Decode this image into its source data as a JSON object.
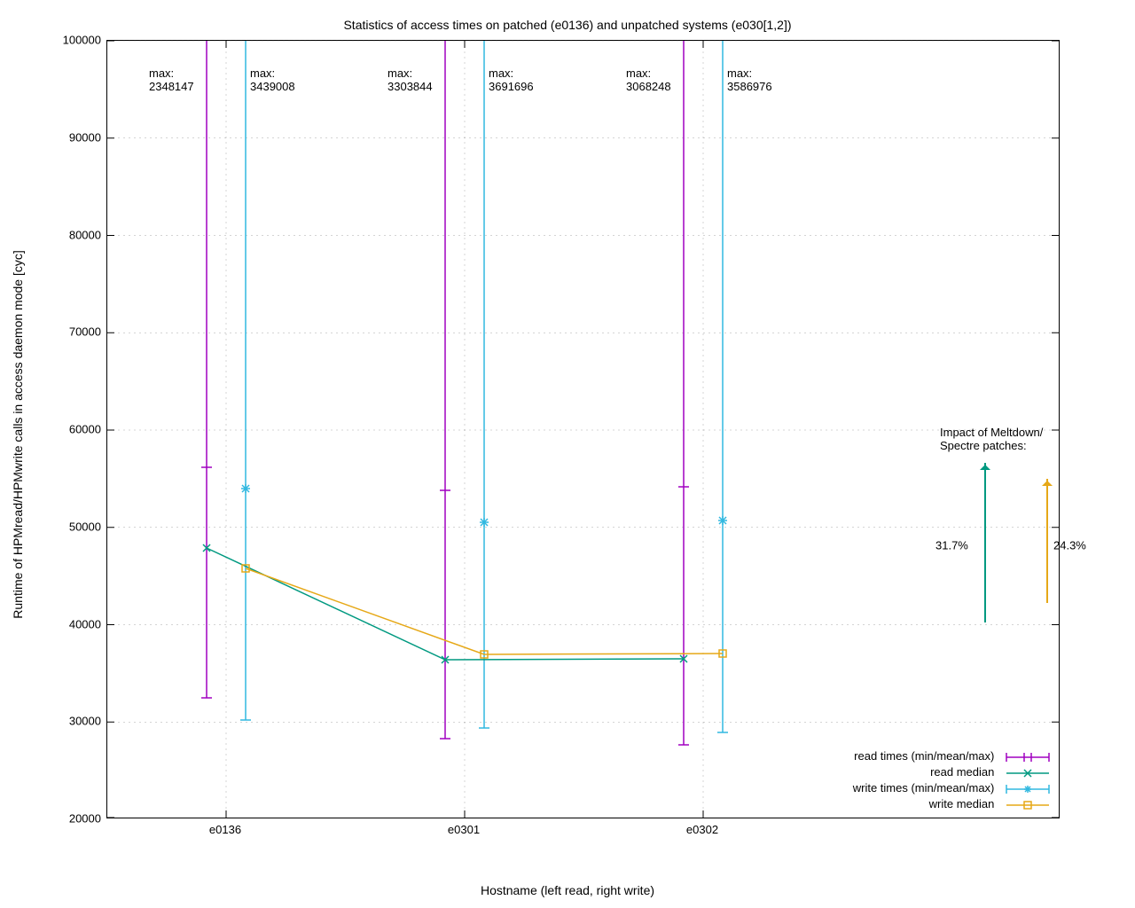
{
  "chart_data": {
    "type": "line",
    "title": "Statistics of access times on patched (e0136) and unpatched systems (e030[1,2])",
    "xlabel": "Hostname (left read, right write)",
    "ylabel": "Runtime of HPMread/HPMwrite calls in access daemon mode [cyc]",
    "categories": [
      "e0136",
      "e0301",
      "e0302"
    ],
    "ylim": [
      20000,
      100000
    ],
    "yticks": [
      20000,
      30000,
      40000,
      50000,
      60000,
      70000,
      80000,
      90000,
      100000
    ],
    "series": [
      {
        "name": "read times (min/mean/max)",
        "color": "#a000c0",
        "kind": "errorbar",
        "x_offset": -0.08,
        "points": [
          {
            "cat": "e0136",
            "mean": 47700,
            "min": 32300,
            "max": 2348147,
            "tick": 56000
          },
          {
            "cat": "e0301",
            "mean": 36200,
            "min": 28100,
            "max": 3303844,
            "tick": 53600
          },
          {
            "cat": "e0302",
            "mean": 36300,
            "min": 27500,
            "max": 3068248,
            "tick": 54000
          }
        ]
      },
      {
        "name": "read median",
        "color": "#009980",
        "kind": "line",
        "marker": "x",
        "x_offset": -0.08,
        "values": [
          47700,
          36200,
          36300
        ]
      },
      {
        "name": "write times (min/mean/max)",
        "color": "#30b8e0",
        "kind": "errorbar",
        "x_offset": 0.08,
        "points": [
          {
            "cat": "e0136",
            "mean": 45600,
            "min": 30000,
            "max": 3439008,
            "tick": 53800
          },
          {
            "cat": "e0301",
            "mean": 36800,
            "min": 29200,
            "max": 3691696,
            "tick": 50400
          },
          {
            "cat": "e0302",
            "mean": 36900,
            "min": 28800,
            "max": 3586976,
            "tick": 50500
          }
        ]
      },
      {
        "name": "write median",
        "color": "#e6a817",
        "kind": "line",
        "marker": "square",
        "x_offset": 0.08,
        "values": [
          45600,
          36800,
          36900
        ]
      }
    ],
    "annotations": {
      "max_labels": [
        {
          "text_prefix": "max:",
          "value": "2348147"
        },
        {
          "text_prefix": "max:",
          "value": "3439008"
        },
        {
          "text_prefix": "max:",
          "value": "3303844"
        },
        {
          "text_prefix": "max:",
          "value": "3691696"
        },
        {
          "text_prefix": "max:",
          "value": "3068248"
        },
        {
          "text_prefix": "max:",
          "value": "3586976"
        }
      ],
      "impact": {
        "heading": "Impact of Meltdown/\nSpectre patches:",
        "read_pct": "31.7%",
        "write_pct": "24.3%",
        "colors": {
          "read": "#009980",
          "write": "#e6a817"
        }
      }
    },
    "legend_labels": {
      "read_err": "read times (min/mean/max)",
      "read_med": "read median",
      "write_err": "write times (min/mean/max)",
      "write_med": "write median"
    }
  }
}
